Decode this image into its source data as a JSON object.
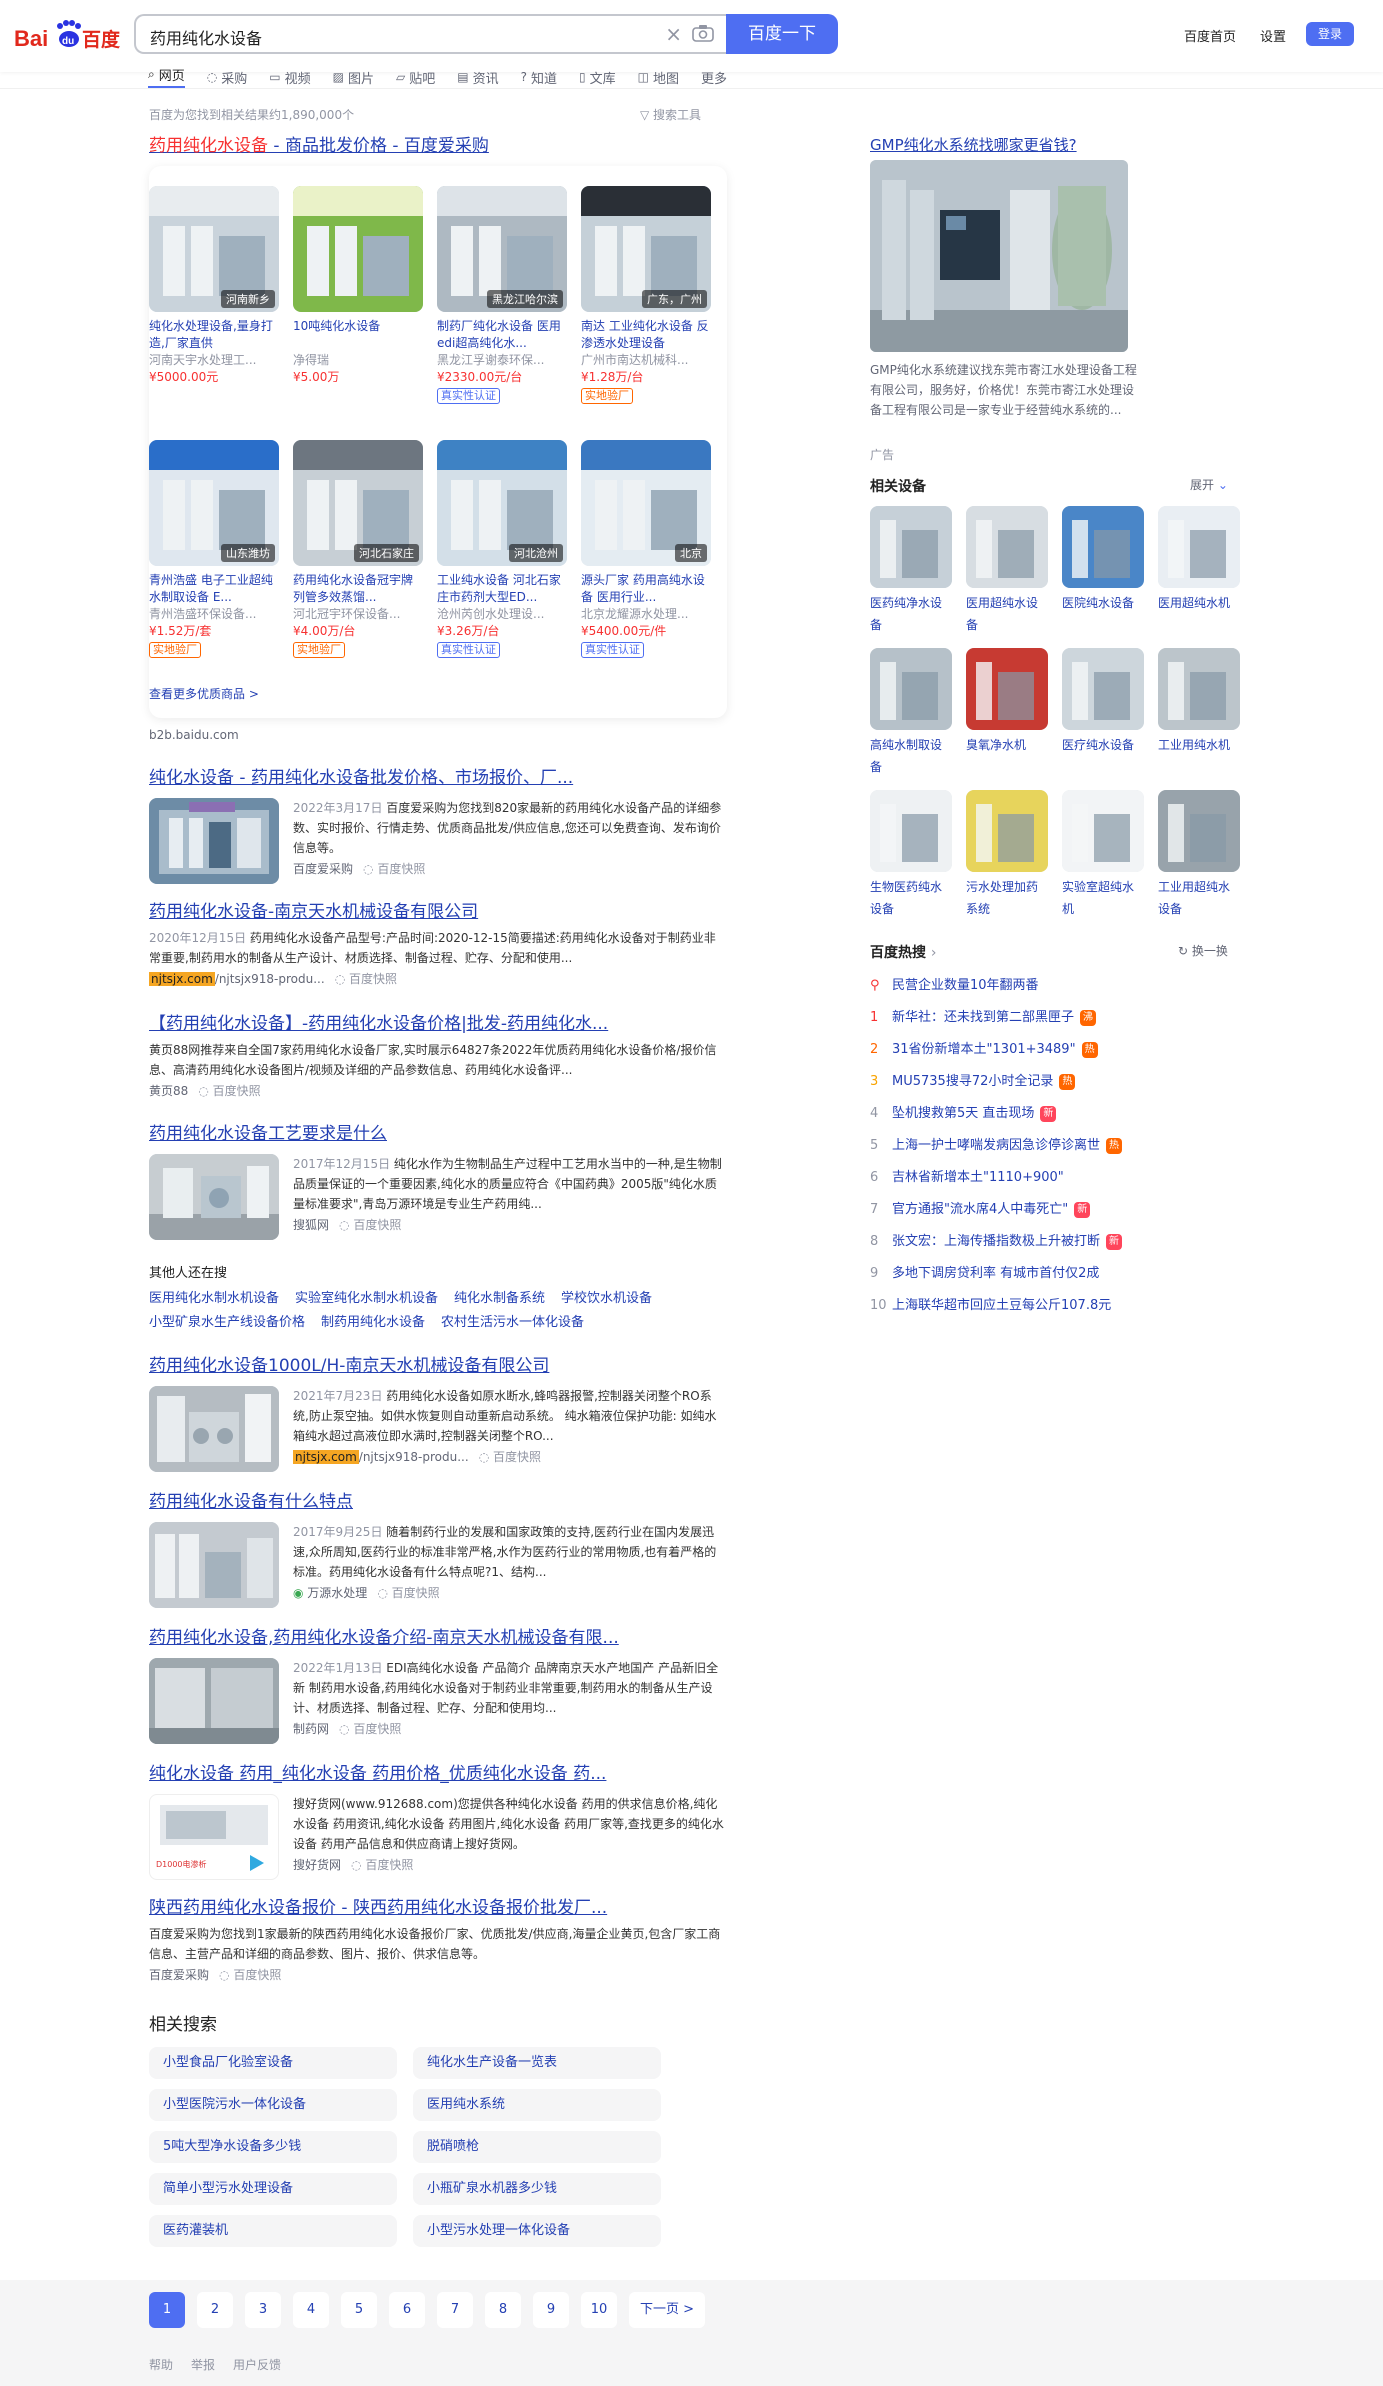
{
  "header": {
    "logo_text": "Bai百度",
    "query": "药用纯化水设备",
    "search_button": "百度一下",
    "links": [
      "百度首页",
      "设置"
    ],
    "login": "登录"
  },
  "tabs": [
    {
      "label": "网页",
      "icon": "search-icon",
      "active": true
    },
    {
      "label": "采购",
      "icon": "cart-icon"
    },
    {
      "label": "视频",
      "icon": "video-icon"
    },
    {
      "label": "图片",
      "icon": "image-icon"
    },
    {
      "label": "贴吧",
      "icon": "tieba-icon"
    },
    {
      "label": "资讯",
      "icon": "news-icon"
    },
    {
      "label": "知道",
      "icon": "question-icon"
    },
    {
      "label": "文库",
      "icon": "doc-icon"
    },
    {
      "label": "地图",
      "icon": "map-icon"
    },
    {
      "label": "更多",
      "icon": ""
    }
  ],
  "result_count": "百度为您找到相关结果约1,890,000个",
  "search_tools": "搜索工具",
  "first_result": {
    "title_red": "药用纯化水设备",
    "title_rest": " - 商品批发价格 - 百度爱采购",
    "more": "查看更多优质商品 >",
    "source": "b2b.baidu.com",
    "products": [
      {
        "name": "纯化水处理设备,量身打造,厂家直供",
        "company": "河南天宇水处理工...",
        "price": "¥5000.00元",
        "location": "河南新乡",
        "tag": ""
      },
      {
        "name": "10吨纯化水设备",
        "company": "净得瑞",
        "price": "¥5.00万",
        "location": "",
        "tag": ""
      },
      {
        "name": "制药厂纯化水设备 医用edi超高纯化水...",
        "company": "黑龙江孚谢泰环保...",
        "price": "¥2330.00元/台",
        "location": "黑龙江哈尔滨",
        "tag": "真实性认证"
      },
      {
        "name": "南达 工业纯化水设备 反渗透水处理设备",
        "company": "广州市南达机械科...",
        "price": "¥1.28万/台",
        "location": "广东，广州",
        "tag": "实地验厂"
      },
      {
        "name": "青州浩盛 电子工业超纯水制取设备 E...",
        "company": "青州浩盛环保设备...",
        "price": "¥1.52万/套",
        "location": "山东潍坊",
        "tag": "实地验厂"
      },
      {
        "name": "药用纯化水设备冠宇牌列管多效蒸馏...",
        "company": "河北冠宇环保设备...",
        "price": "¥4.00万/台",
        "location": "河北石家庄",
        "tag": "实地验厂"
      },
      {
        "name": "工业纯水设备 河北石家庄市药剂大型ED...",
        "company": "沧州芮创水处理设...",
        "price": "¥3.26万/台",
        "location": "河北沧州",
        "tag": "真实性认证"
      },
      {
        "name": "源头厂家 药用高纯水设备 医用行业...",
        "company": "北京龙耀源水处理...",
        "price": "¥5400.00元/件",
        "location": "北京",
        "tag": "真实性认证"
      }
    ]
  },
  "results": [
    {
      "title": "纯化水设备 - 药用纯化水设备批发价格、市场报价、厂...",
      "date": "2022年3月17日",
      "snippet": "百度爱采购为您找到820家最新的药用纯化水设备产品的详细参数、实时报价、行情走势、优质商品批发/供应信息,您还可以免费查询、发布询价信息等。",
      "site": "百度爱采购",
      "cache": "百度快照"
    },
    {
      "title": "药用纯化水设备-南京天水机械设备有限公司",
      "date": "2020年12月15日",
      "snippet": "药用纯化水设备产品型号:产品时间:2020-12-15简要描述:药用纯化水设备对于制药业非常重要,制药用水的制备从生产设计、材质选择、制备过程、贮存、分配和使用...",
      "site_highlight": "njtsjx.com",
      "site_rest": "/njtsjx918-produ...",
      "cache": "百度快照"
    },
    {
      "title": "【药用纯化水设备】-药用纯化水设备价格|批发-药用纯化水...",
      "snippet": "黄页88网推荐来自全国7家药用纯化水设备厂家,实时展示64827条2022年优质药用纯化水设备价格/报价信息、高清药用纯化水设备图片/视频及详细的产品参数信息、药用纯化水设备评...",
      "site": "黄页88",
      "cache": "百度快照"
    },
    {
      "title": "药用纯化水设备工艺要求是什么",
      "date": "2017年12月15日",
      "snippet": "纯化水作为生物制品生产过程中工艺用水当中的一种,是生物制品质量保证的一个重要因素,纯化水的质量应符合《中国药典》2005版\"纯化水质量标准要求\",青岛万源环境是专业生产药用纯...",
      "site": "搜狐网",
      "cache": "百度快照"
    },
    {
      "title": "药用纯化水设备1000L/H-南京天水机械设备有限公司",
      "date": "2021年7月23日",
      "snippet": "药用纯化水设备如原水断水,蜂鸣器报警,控制器关闭整个RO系统,防止泵空抽。如供水恢复则自动重新启动系统。 纯水箱液位保护功能: 如纯水箱纯水超过高液位即水满时,控制器关闭整个RO...",
      "site_highlight": "njtsjx.com",
      "site_rest": "/njtsjx918-produ...",
      "cache": "百度快照"
    },
    {
      "title": "药用纯化水设备有什么特点",
      "date": "2017年9月25日",
      "snippet": "随着制药行业的发展和国家政策的支持,医药行业在国内发展迅速,众所周知,医药行业的标准非常严格,水作为医药行业的常用物质,也有着严格的标准。药用纯化水设备有什么特点呢?1、结构...",
      "site": "万源水处理",
      "cache": "百度快照"
    },
    {
      "title": "药用纯化水设备,药用纯化水设备介绍-南京天水机械设备有限...",
      "date": "2022年1月13日",
      "snippet": "EDI高纯化水设备 产品简介 品牌南京天水产地国产 产品新旧全新 制药用水设备,药用纯化水设备对于制药业非常重要,制药用水的制备从生产设计、材质选择、制备过程、贮存、分配和使用均...",
      "site": "制药网",
      "cache": "百度快照"
    },
    {
      "title": "纯化水设备 药用_纯化水设备 药用价格_优质纯化水设备 药...",
      "snippet": "搜好货网(www.912688.com)您提供各种纯化水设备 药用的供求信息价格,纯化水设备 药用资讯,纯化水设备 药用图片,纯化水设备 药用厂家等,查找更多的纯化水设备 药用产品信息和供应商请上搜好货网。",
      "site": "搜好货网",
      "cache": "百度快照"
    },
    {
      "title": "陕西药用纯化水设备报价 - 陕西药用纯化水设备报价批发厂...",
      "snippet": "百度爱采购为您找到1家最新的陕西药用纯化水设备报价厂家、优质批发/供应商,海量企业黄页,包含厂家工商信息、主营产品和详细的商品参数、图片、报价、供求信息等。",
      "site": "百度爱采购",
      "cache": "百度快照"
    }
  ],
  "others": {
    "heading": "其他人还在搜",
    "row1": [
      "医用纯化水制水机设备",
      "实验室纯化水制水机设备",
      "纯化水制备系统",
      "学校饮水机设备"
    ],
    "row2": [
      "小型矿泉水生产线设备价格",
      "制药用纯化水设备",
      "农村生活污水一体化设备"
    ]
  },
  "related": {
    "heading": "相关搜索",
    "items": [
      "小型食品厂化验室设备",
      "纯化水生产设备一览表",
      "小型医院污水一体化设备",
      "医用纯水系统",
      "5吨大型净水设备多少钱",
      "脱硝喷枪",
      "简单小型污水处理设备",
      "小瓶矿泉水机器多少钱",
      "医药灌装机",
      "小型污水处理一体化设备"
    ]
  },
  "pager": {
    "pages": [
      "1",
      "2",
      "3",
      "4",
      "5",
      "6",
      "7",
      "8",
      "9",
      "10"
    ],
    "next": "下一页 >"
  },
  "footer": [
    "帮助",
    "举报",
    "用户反馈"
  ],
  "side": {
    "ad_title": "GMP纯化水系统找哪家更省钱?",
    "ad_text": "GMP纯化水系统建议找东莞市寄江水处理设备工程有限公司，服务好，价格优！东莞市寄江水处理设备工程有限公司是一家专业于经营纯水系统的...",
    "ad_label": "广告",
    "equip_title": "相关设备",
    "equip_expand": "展开",
    "equip": [
      "医药纯净水设备",
      "医用超纯水设备",
      "医院纯水设备",
      "医用超纯水机",
      "高纯水制取设备",
      "臭氧净水机",
      "医疗纯水设备",
      "工业用纯水机",
      "生物医药纯水设备",
      "污水处理加药系统",
      "实验室超纯水机",
      "工业用超纯水设备"
    ],
    "hot_title": "百度热搜",
    "hot_refresh": "换一换",
    "hot": [
      {
        "n": "",
        "text": "民营企业数量10年翻两番",
        "badge": ""
      },
      {
        "n": "1",
        "text": "新华社：还未找到第二部黑匣子",
        "badge": "沸"
      },
      {
        "n": "2",
        "text": "31省份新增本土\"1301+3489\"",
        "badge": "热"
      },
      {
        "n": "3",
        "text": "MU5735搜寻72小时全记录",
        "badge": "热"
      },
      {
        "n": "4",
        "text": "坠机搜救第5天 直击现场",
        "badge": "新"
      },
      {
        "n": "5",
        "text": "上海一护士哮喘发病因急诊停诊离世",
        "badge": "热"
      },
      {
        "n": "6",
        "text": "吉林省新增本土\"1110+900\"",
        "badge": ""
      },
      {
        "n": "7",
        "text": "官方通报\"流水席4人中毒死亡\"",
        "badge": "新"
      },
      {
        "n": "8",
        "text": "张文宏：上海传播指数极上升被打断",
        "badge": "新"
      },
      {
        "n": "9",
        "text": "多地下调房贷利率 有城市首付仅2成",
        "badge": ""
      },
      {
        "n": "10",
        "text": "上海联华超市回应土豆每公斤107.8元",
        "badge": ""
      }
    ]
  }
}
